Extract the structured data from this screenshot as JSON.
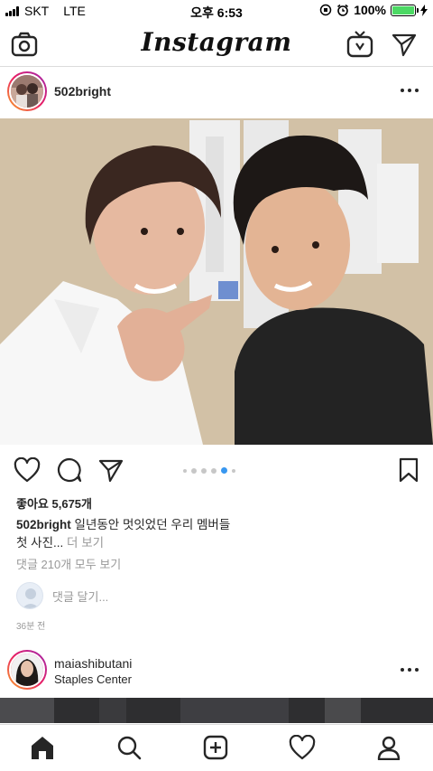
{
  "status_bar": {
    "carrier": "SKT",
    "network": "LTE",
    "time": "오후 6:53",
    "battery_percent": "100%",
    "battery_level": 1.0
  },
  "top_nav": {
    "brand": "Instagram",
    "left_icon": "camera-icon",
    "right_icons": [
      "igtv-icon",
      "direct-message-icon"
    ]
  },
  "post": {
    "username": "502bright",
    "image_description_icon": "photo",
    "carousel": {
      "total": 6,
      "active_index": 4
    },
    "likes": "좋아요 5,675개",
    "caption_username": "502bright",
    "caption_text_line1": "일년동안 멋잇었던 우리 멤버들",
    "caption_text_line2": "첫 사진...",
    "caption_more": "더 보기",
    "view_comments": "댓글 210개 모두 보기",
    "add_comment_placeholder": "댓글 달기...",
    "time_ago": "36분 전"
  },
  "next_post": {
    "username": "maiashibutani",
    "location": "Staples Center"
  },
  "bottom_nav": {
    "tabs": [
      "home-icon",
      "search-icon",
      "new-post-icon",
      "activity-heart-icon",
      "profile-icon"
    ]
  },
  "colors": {
    "accent": "#262626",
    "muted": "#999999",
    "divider": "#dbdbdb",
    "battery": "#4cd964"
  }
}
